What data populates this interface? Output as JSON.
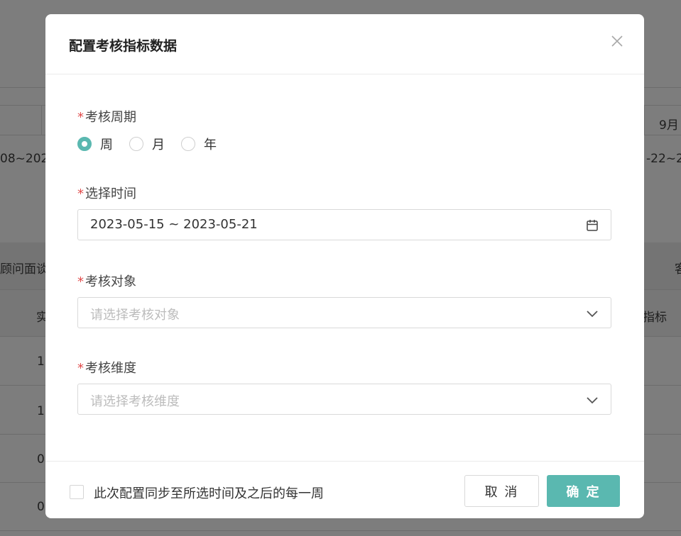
{
  "background": {
    "texts": [
      "9月",
      "08~202",
      "-22~2",
      "顾问面谈",
      "客",
      "实",
      "指标",
      "1",
      "1",
      "0",
      "0"
    ]
  },
  "dialog": {
    "title": "配置考核指标数据",
    "close_icon": "close-icon"
  },
  "form": {
    "required_mark": "*",
    "period": {
      "label": "考核周期",
      "options": [
        "周",
        "月",
        "年"
      ],
      "selected": "周"
    },
    "time": {
      "label": "选择时间",
      "value": "2023-05-15 ~ 2023-05-21",
      "icon": "calendar-icon"
    },
    "target": {
      "label": "考核对象",
      "placeholder": "请选择考核对象",
      "icon": "chevron-down-icon"
    },
    "dimension": {
      "label": "考核维度",
      "placeholder": "请选择考核维度",
      "icon": "chevron-down-icon"
    }
  },
  "footer": {
    "sync_label": "此次配置同步至所选时间及之后的每一周",
    "cancel_label": "取 消",
    "ok_label": "确 定"
  },
  "colors": {
    "accent": "#5ab8b0",
    "required": "#e14b4b"
  }
}
